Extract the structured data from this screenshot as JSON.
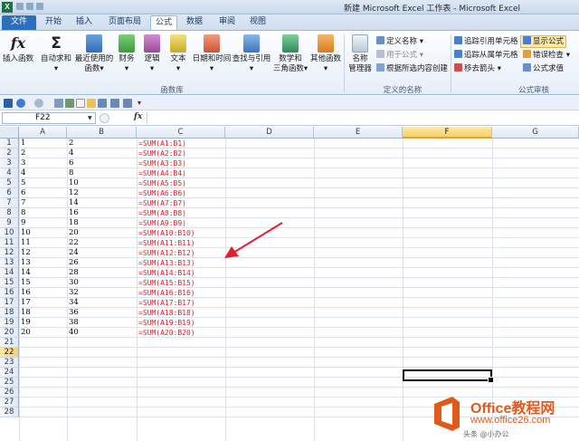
{
  "window": {
    "title": "新建 Microsoft Excel 工作表 - Microsoft Excel",
    "app_logo": "X"
  },
  "tabs": [
    "文件",
    "开始",
    "插入",
    "页面布局",
    "公式",
    "数据",
    "审阅",
    "视图"
  ],
  "active_tab": "公式",
  "ribbon": {
    "insert_function": "插入函数",
    "autosum": "自动求和",
    "recent_1": "最近使用的",
    "recent_2": "函数",
    "financial": "财务",
    "logical": "逻辑",
    "text": "文本",
    "datetime": "日期和时间",
    "lookup": "查找与引用",
    "math_1": "数学和",
    "math_2": "三角函数",
    "other": "其他函数",
    "library_label": "函数库",
    "name_manager_1": "名称",
    "name_manager_2": "管理器",
    "define_name": "定义名称",
    "use_in_formula": "用于公式",
    "create_from_selection": "根据所选内容创建",
    "defined_names_label": "定义的名称",
    "trace_precedents": "追踪引用单元格",
    "trace_dependents": "追踪从属单元格",
    "remove_arrows": "移去箭头",
    "show_formulas": "显示公式",
    "error_checking": "错误检查",
    "evaluate_formula": "公式求值",
    "auditing_label": "公式审核"
  },
  "formula_bar": {
    "name_box": "F22",
    "fx": "fx",
    "value": ""
  },
  "columns": [
    "A",
    "B",
    "C",
    "D",
    "E",
    "F",
    "G"
  ],
  "selected_column": "F",
  "selected_row": "22",
  "rows": [
    "1",
    "2",
    "3",
    "4",
    "5",
    "6",
    "7",
    "8",
    "9",
    "10",
    "11",
    "12",
    "13",
    "14",
    "15",
    "16",
    "17",
    "18",
    "19",
    "20",
    "21",
    "22",
    "23",
    "24",
    "25",
    "26",
    "27",
    "28"
  ],
  "cells": {
    "A": [
      "1",
      "2",
      "3",
      "4",
      "5",
      "6",
      "7",
      "8",
      "9",
      "10",
      "11",
      "12",
      "13",
      "14",
      "15",
      "16",
      "17",
      "18",
      "19",
      "20"
    ],
    "B": [
      "2",
      "4",
      "6",
      "8",
      "10",
      "12",
      "14",
      "16",
      "18",
      "20",
      "22",
      "24",
      "26",
      "28",
      "30",
      "32",
      "34",
      "36",
      "38",
      "40"
    ],
    "C": [
      "=SUM(A1:B1)",
      "=SUM(A2:B2)",
      "=SUM(A3:B3)",
      "=SUM(A4:B4)",
      "=SUM(A5:B5)",
      "=SUM(A6:B6)",
      "=SUM(A7:B7)",
      "=SUM(A8:B8)",
      "=SUM(A9:B9)",
      "=SUM(A10:B10)",
      "=SUM(A11:B11)",
      "=SUM(A12:B12)",
      "=SUM(A13:B13)",
      "=SUM(A14:B14)",
      "=SUM(A15:B15)",
      "=SUM(A16:B16)",
      "=SUM(A17:B17)",
      "=SUM(A18:B18)",
      "=SUM(A19:B19)",
      "=SUM(A20:B20)"
    ]
  },
  "colors": {
    "formula_text": "#e0202f",
    "annotation_arrow": "#e0202f",
    "file_tab": "#2b6fbf"
  },
  "watermark": {
    "title": "Office教程网",
    "url": "www.office26.com",
    "credit": "头条 @小办公"
  }
}
